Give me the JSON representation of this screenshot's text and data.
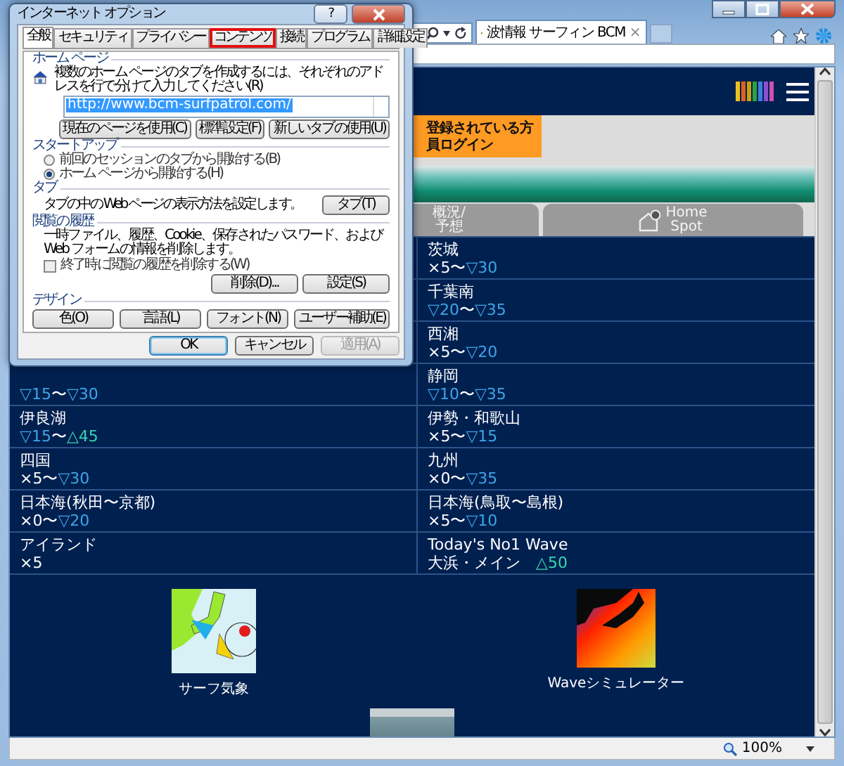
{
  "browser": {
    "tab": {
      "title": "波情報 サーフィン BCM",
      "close": "×"
    },
    "status_bar": {
      "zoom": "100%"
    }
  },
  "site": {
    "login": {
      "line1": "登録されている方",
      "line2": "員ログイン"
    },
    "nav": [
      {
        "lines": [
          "概況/",
          "予想"
        ],
        "kind": "text"
      },
      {
        "lines": [
          "Home",
          "Spot"
        ],
        "kind": "icon"
      }
    ],
    "rows": [
      {
        "right": {
          "name": "茨城",
          "wave": [
            {
              "kind": "flat",
              "text": "×5"
            },
            {
              "kind": "flat",
              "text": "〜"
            },
            {
              "kind": "down",
              "text": "▽30"
            }
          ]
        }
      },
      {
        "right": {
          "name": "千葉南",
          "wave": [
            {
              "kind": "down",
              "text": "▽20"
            },
            {
              "kind": "flat",
              "text": "〜"
            },
            {
              "kind": "down",
              "text": "▽35"
            }
          ]
        }
      },
      {
        "right": {
          "name": "西湘",
          "wave": [
            {
              "kind": "flat",
              "text": "×5"
            },
            {
              "kind": "flat",
              "text": "〜"
            },
            {
              "kind": "down",
              "text": "▽20"
            }
          ]
        }
      },
      {
        "left": {
          "wave": [
            {
              "kind": "down",
              "text": "▽15"
            },
            {
              "kind": "flat",
              "text": "〜"
            },
            {
              "kind": "down",
              "text": "▽30"
            }
          ]
        },
        "right": {
          "name": "静岡",
          "wave": [
            {
              "kind": "down",
              "text": "▽10"
            },
            {
              "kind": "flat",
              "text": "〜"
            },
            {
              "kind": "down",
              "text": "▽35"
            }
          ]
        }
      },
      {
        "left": {
          "name": "伊良湖",
          "wave": [
            {
              "kind": "down",
              "text": "▽15"
            },
            {
              "kind": "flat",
              "text": "〜"
            },
            {
              "kind": "up",
              "text": "△45"
            }
          ]
        },
        "right": {
          "name": "伊勢・和歌山",
          "wave": [
            {
              "kind": "flat",
              "text": "×5"
            },
            {
              "kind": "flat",
              "text": "〜"
            },
            {
              "kind": "down",
              "text": "▽15"
            }
          ]
        }
      },
      {
        "left": {
          "name": "四国",
          "wave": [
            {
              "kind": "flat",
              "text": "×5"
            },
            {
              "kind": "flat",
              "text": "〜"
            },
            {
              "kind": "down",
              "text": "▽30"
            }
          ]
        },
        "right": {
          "name": "九州",
          "wave": [
            {
              "kind": "flat",
              "text": "×0"
            },
            {
              "kind": "flat",
              "text": "〜"
            },
            {
              "kind": "down",
              "text": "▽35"
            }
          ]
        }
      },
      {
        "left": {
          "name": "日本海(秋田〜京都)",
          "wave": [
            {
              "kind": "flat",
              "text": "×0"
            },
            {
              "kind": "flat",
              "text": "〜"
            },
            {
              "kind": "down",
              "text": "▽20"
            }
          ]
        },
        "right": {
          "name": "日本海(鳥取〜島根)",
          "wave": [
            {
              "kind": "flat",
              "text": "×5"
            },
            {
              "kind": "flat",
              "text": "〜"
            },
            {
              "kind": "down",
              "text": "▽10"
            }
          ]
        }
      },
      {
        "left": {
          "name": "アイランド",
          "wave": [
            {
              "kind": "flat",
              "text": "×5"
            }
          ]
        },
        "right": {
          "name": "Today's No1 Wave",
          "wave": [
            {
              "kind": "flat",
              "text": "大浜・メイン　"
            },
            {
              "kind": "up",
              "text": "△50"
            }
          ]
        }
      }
    ],
    "features": [
      {
        "kind": "map",
        "label": "サーフ気象"
      },
      {
        "kind": "heatmap",
        "label": "Waveシミュレーター"
      },
      {
        "kind": "photo"
      }
    ]
  },
  "dialog": {
    "title": "インターネット オプション",
    "help": "?",
    "tabs": [
      {
        "label": "全般",
        "selected": true,
        "highlighted": false
      },
      {
        "label": "セキュリティ",
        "selected": false,
        "highlighted": false
      },
      {
        "label": "プライバシー",
        "selected": false,
        "highlighted": false
      },
      {
        "label": "コンテンツ",
        "selected": false,
        "highlighted": true
      },
      {
        "label": "接続",
        "selected": false,
        "highlighted": false
      },
      {
        "label": "プログラム",
        "selected": false,
        "highlighted": false
      },
      {
        "label": "詳細設定",
        "selected": false,
        "highlighted": false
      }
    ],
    "home": {
      "legend": "ホーム ページ",
      "description": "複数のホーム ページのタブを作成するには、それぞれのアドレスを行で分けて入力してください(R)",
      "url": "http://www.bcm-surfpatrol.com/",
      "buttons": [
        "現在のページを使用(C)",
        "標準設定(F)",
        "新しいタブの使用(U)"
      ]
    },
    "startup": {
      "legend": "スタートアップ",
      "options": [
        {
          "label": "前回のセッションのタブから開始する(B)",
          "selected": false
        },
        {
          "label": "ホーム ページから開始する(H)",
          "selected": true
        }
      ]
    },
    "tab_settings": {
      "legend": "タブ",
      "description": "タブの中の Web ページの表示方法を設定します。",
      "button": "タブ(T)"
    },
    "history": {
      "legend": "閲覧の履歴",
      "description": "一時ファイル、履歴、Cookie、保存されたパスワード、および Web フォームの情報を削除します。",
      "checkbox": {
        "label": "終了時に閲覧の履歴を削除する(W)",
        "checked": false
      },
      "buttons": [
        "削除(D)...",
        "設定(S)"
      ]
    },
    "design": {
      "legend": "デザイン",
      "buttons": [
        "色(O)",
        "言語(L)",
        "フォント(N)",
        "ユーザー補助(E)"
      ]
    },
    "footer": [
      {
        "label": "OK",
        "default": true,
        "disabled": false
      },
      {
        "label": "キャンセル",
        "default": false,
        "disabled": false
      },
      {
        "label": "適用(A)",
        "default": false,
        "disabled": true
      }
    ]
  }
}
